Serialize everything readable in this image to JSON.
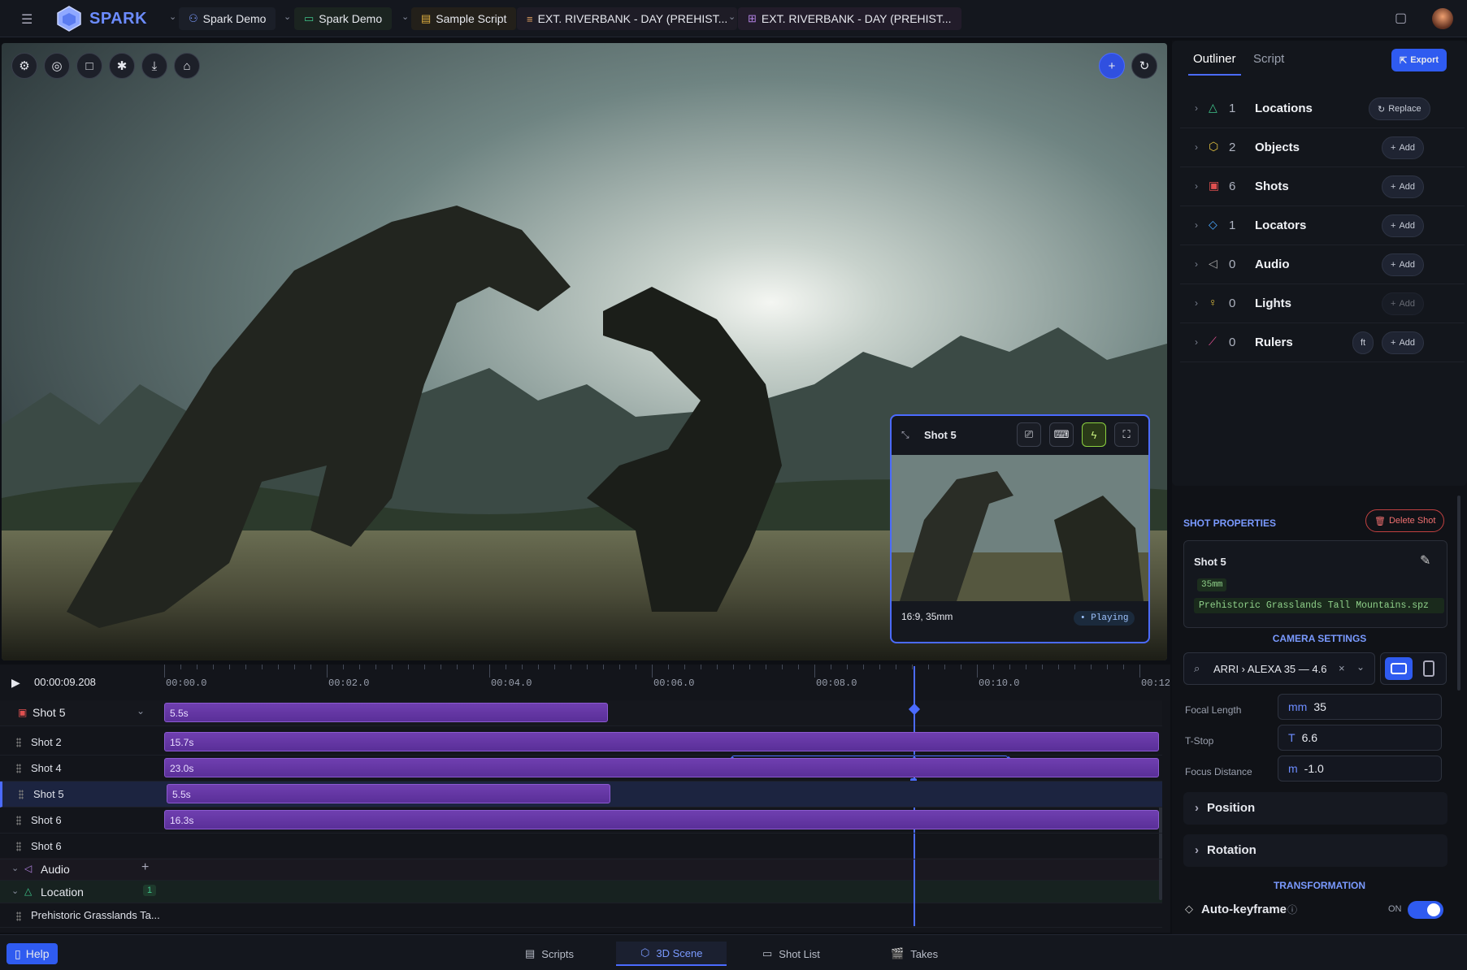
{
  "app": {
    "name": "SPARK"
  },
  "breadcrumbs": [
    {
      "label": "Spark Demo",
      "icon": "user-icon"
    },
    {
      "label": "Spark Demo",
      "icon": "camera-icon"
    },
    {
      "label": "Sample Script",
      "icon": "document-icon"
    },
    {
      "label": "EXT. RIVERBANK - DAY (PREHIST...",
      "icon": "list-icon"
    },
    {
      "label": "EXT. RIVERBANK - DAY (PREHIST...",
      "icon": "grid-icon"
    }
  ],
  "preview": {
    "title": "Shot 5",
    "caption": "16:9, 35mm",
    "status": "Playing"
  },
  "timeline": {
    "timecode": "00:00:09.208",
    "ruler": [
      "00:00.0",
      "00:02.0",
      "00:04.0",
      "00:06.0",
      "00:08.0",
      "00:10.0",
      "00:12"
    ],
    "selected_shot": "Shot 5",
    "shots": [
      {
        "label": "Shot 2",
        "duration": "15.7s"
      },
      {
        "label": "Shot 4",
        "duration": "23.0s"
      },
      {
        "label": "Shot 5",
        "duration": "5.5s"
      },
      {
        "label": "Shot 6",
        "duration": "16.3s"
      },
      {
        "label": "Shot 6",
        "duration": ""
      }
    ],
    "header_bar": "5.5s",
    "audio_label": "Audio",
    "location_label": "Location",
    "location_count": "1",
    "location_item": "Prehistoric Grasslands Ta..."
  },
  "outliner": {
    "tabs": [
      "Outliner",
      "Script"
    ],
    "export_label": "Export",
    "rows": [
      {
        "count": "1",
        "name": "Locations",
        "action": "Replace",
        "icon": "mountain-icon",
        "color": "#3ec48a"
      },
      {
        "count": "2",
        "name": "Objects",
        "action": "Add",
        "icon": "cube-icon",
        "color": "#e0c040"
      },
      {
        "count": "6",
        "name": "Shots",
        "action": "Add",
        "icon": "film-icon",
        "color": "#e05050"
      },
      {
        "count": "1",
        "name": "Locators",
        "action": "Add",
        "icon": "diamond-icon",
        "color": "#4aa8ff"
      },
      {
        "count": "0",
        "name": "Audio",
        "action": "Add",
        "icon": "speaker-icon",
        "color": "#aaaaaa"
      },
      {
        "count": "0",
        "name": "Lights",
        "action": "Add",
        "icon": "bulb-icon",
        "color": "#e0c040"
      },
      {
        "count": "0",
        "name": "Rulers",
        "action": "Add",
        "icon": "ruler-icon",
        "color": "#e05090",
        "unit": "ft"
      }
    ]
  },
  "shot_properties": {
    "heading": "SHOT PROPERTIES",
    "delete_label": "Delete Shot",
    "shot_name": "Shot 5",
    "lens_tag": "35mm",
    "location_file": "Prehistoric Grasslands Tall Mountains.spz",
    "camera_heading": "CAMERA SETTINGS",
    "camera": "ARRI › ALEXA 35 — 4.6",
    "focal_label": "Focal Length",
    "focal_unit": "mm",
    "focal_value": "35",
    "tstop_label": "T-Stop",
    "tstop_unit": "T",
    "tstop_value": "6.6",
    "focus_label": "Focus Distance",
    "focus_unit": "m",
    "focus_value": "-1.0",
    "position_label": "Position",
    "rotation_label": "Rotation",
    "transform_heading": "TRANSFORMATION",
    "autokey_label": "Auto-keyframe",
    "autokey_state": "ON"
  },
  "bottom_tabs": [
    {
      "label": "Scripts",
      "icon": "scripts-icon"
    },
    {
      "label": "3D Scene",
      "icon": "cube-icon",
      "active": true
    },
    {
      "label": "Shot List",
      "icon": "shotlist-icon"
    },
    {
      "label": "Takes",
      "icon": "clapper-icon"
    }
  ],
  "help_label": "Help",
  "colors": {
    "accent": "#4b6bff",
    "clip": "#6f3fb0",
    "playhead": "#4b6bff"
  }
}
